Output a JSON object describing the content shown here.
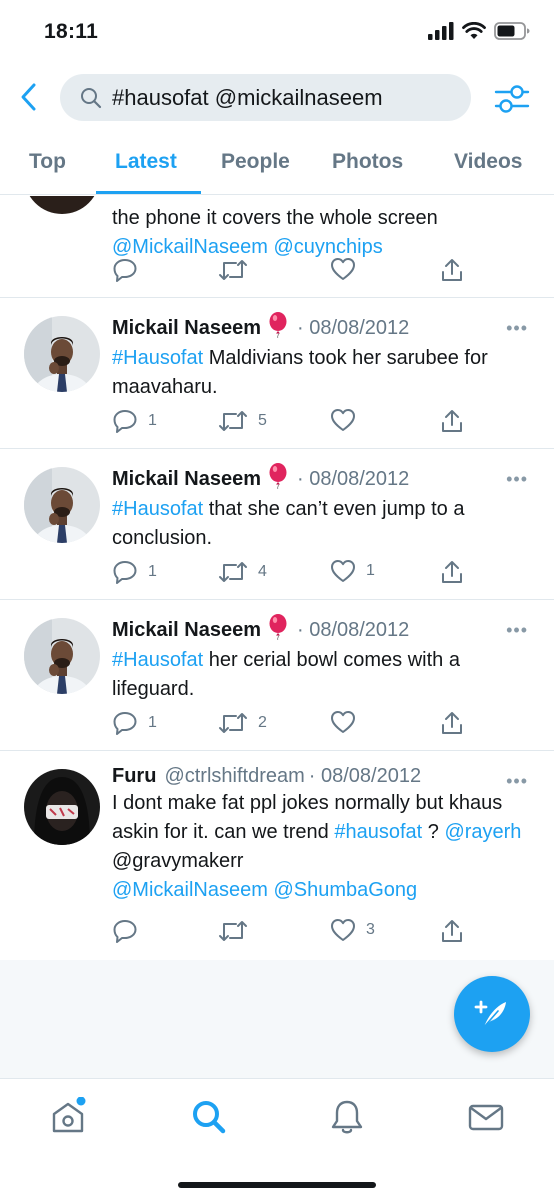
{
  "status": {
    "time": "18:11",
    "icons": [
      "signal-icon",
      "wifi-icon",
      "battery-icon"
    ]
  },
  "search": {
    "query": "#hausofat @mickailnaseem"
  },
  "tabs": [
    {
      "label": "Top"
    },
    {
      "label": "Latest",
      "active": true
    },
    {
      "label": "People"
    },
    {
      "label": "Photos"
    },
    {
      "label": "Videos"
    }
  ],
  "tweets": [
    {
      "partial": true,
      "text_line1": "the phone it covers the whole screen",
      "mention1": "@MickailNaseem",
      "mention2": "@cuynchips",
      "reply_count": "",
      "retweet_count": "",
      "like_count": ""
    },
    {
      "name": "Mickail Naseem",
      "emoji": "🎈",
      "date": "· 08/08/2012",
      "hashtag": "#Hausofat",
      "text": " Maldivians took her sarubee for maavaharu.",
      "reply_count": "1",
      "retweet_count": "5",
      "like_count": ""
    },
    {
      "name": "Mickail Naseem",
      "emoji": "🎈",
      "date": "· 08/08/2012",
      "hashtag": "#Hausofat",
      "text": " that she can’t even jump to a conclusion.",
      "reply_count": "1",
      "retweet_count": "4",
      "like_count": "1"
    },
    {
      "name": "Mickail Naseem",
      "emoji": "🎈",
      "date": "· 08/08/2012",
      "hashtag": "#Hausofat",
      "text": " her cerial bowl comes with a lifeguard.",
      "reply_count": "1",
      "retweet_count": "2",
      "like_count": ""
    },
    {
      "name": "Furu",
      "handle": "@ctrlshiftdream",
      "date": "· 08/08/2012",
      "text1": "I dont make fat ppl jokes normally but khaus askin for it. can we trend ",
      "hashtag": "#hausofat",
      "text2": " ? ",
      "mention1": "@rayerh",
      "text3": " @gravymakerr",
      "mention2": "@MickailNaseem",
      "mention3": "@ShumbaGong",
      "reply_count": "",
      "retweet_count": "",
      "like_count": "3"
    }
  ],
  "more_glyph": "•••",
  "colors": {
    "accent": "#1da1f2",
    "text": "#14171a",
    "muted": "#657786",
    "search_bg": "#e6ecf0",
    "divider": "#e1e8ed",
    "balloon": "#e0245e"
  },
  "bottom_nav": [
    "home-icon",
    "search-icon",
    "notifications-icon",
    "messages-icon"
  ]
}
